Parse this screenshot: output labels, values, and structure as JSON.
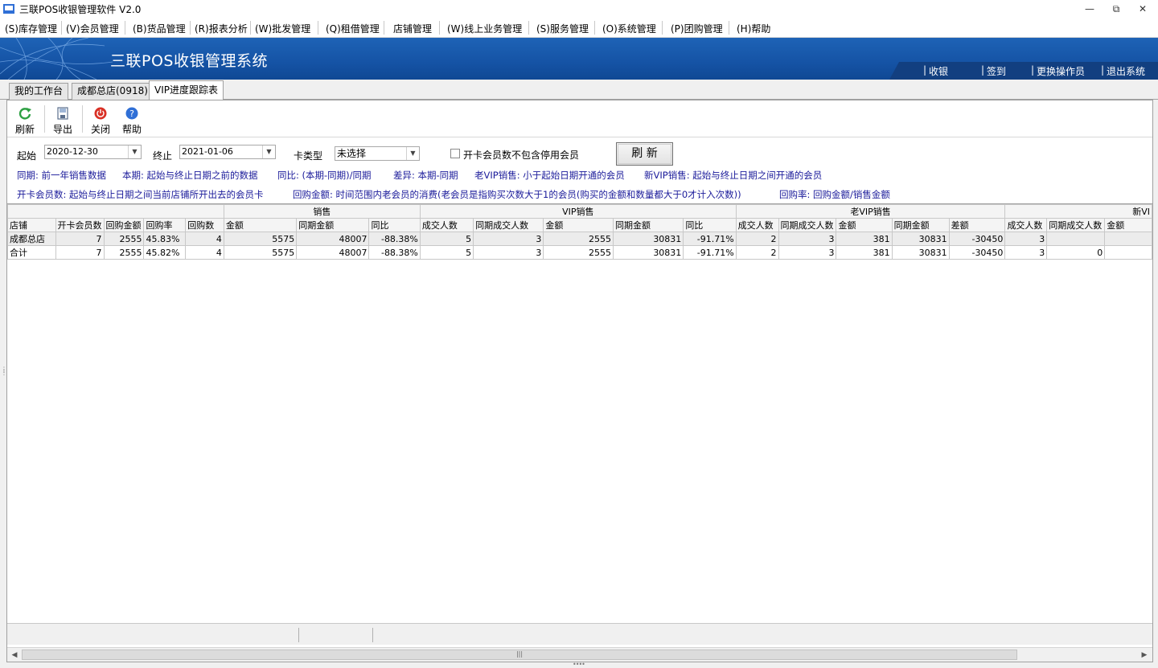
{
  "window": {
    "title": "三联POS收银管理软件 V2.0",
    "controls": {
      "minimize": "—",
      "restore": "⧉",
      "close": "✕"
    }
  },
  "menu": [
    "(S)库存管理",
    "(V)会员管理",
    "(B)货品管理",
    "(R)报表分析",
    "(W)批发管理",
    "(Q)租借管理",
    "店铺管理",
    "(W)线上业务管理",
    "(S)服务管理",
    "(O)系统管理",
    "(P)团购管理",
    "(H)帮助"
  ],
  "banner": {
    "title": "三联POS收银管理系统",
    "links": [
      "收银",
      "签到",
      "更换操作员",
      "退出系统"
    ],
    "link_prefix": "|"
  },
  "tabs": [
    "我的工作台",
    "成都总店(0918)",
    "VIP进度跟踪表"
  ],
  "active_tab": 2,
  "toolbar": {
    "refresh": "刷新",
    "export": "导出",
    "close": "关闭",
    "help": "帮助"
  },
  "filters": {
    "start_label": "起始",
    "start_value": "2020-12-30",
    "end_label": "终止",
    "end_value": "2021-01-06",
    "card_type_label": "卡类型",
    "card_type_value": "未选择",
    "exclude_label": "开卡会员数不包含停用会员",
    "refresh_button": "刷 新"
  },
  "legend": {
    "line1": [
      "同期: 前一年销售数据",
      "本期: 起始与终止日期之前的数据",
      "同比: (本期-同期)/同期",
      "差异: 本期-同期",
      "老VIP销售: 小于起始日期开通的会员",
      "新VIP销售: 起始与终止日期之间开通的会员"
    ],
    "line2": [
      "开卡会员数: 起始与终止日期之间当前店铺所开出去的会员卡",
      "回购金额: 时间范围内老会员的消费(老会员是指购买次数大于1的会员(购买的金额和数量都大于0才计入次数))",
      "回购率: 回购金额/销售金额"
    ]
  },
  "grid": {
    "groups": [
      "",
      "销售",
      "VIP销售",
      "老VIP销售",
      "新VI"
    ],
    "columns": [
      "店铺",
      "开卡会员数",
      "回购金额",
      "回购率",
      "回购数",
      "金额",
      "同期金额",
      "同比",
      "成交人数",
      "同期成交人数",
      "金额",
      "同期金额",
      "同比",
      "成交人数",
      "同期成交人数",
      "金额",
      "同期金额",
      "差额",
      "成交人数",
      "同期成交人数",
      "金额"
    ],
    "rows": [
      [
        "成都总店",
        "7",
        "2555",
        "45.83%",
        "4",
        "5575",
        "48007",
        "-88.38%",
        "5",
        "3",
        "2555",
        "30831",
        "-91.71%",
        "2",
        "3",
        "381",
        "30831",
        "-30450",
        "3",
        "",
        ""
      ],
      [
        "合计",
        "7",
        "2555",
        "45.82%",
        "4",
        "5575",
        "48007",
        "-88.38%",
        "5",
        "3",
        "2555",
        "30831",
        "-91.71%",
        "2",
        "3",
        "381",
        "30831",
        "-30450",
        "3",
        "0",
        ""
      ]
    ]
  },
  "scrollbar": {
    "thumb_grip": "|||"
  },
  "colors": {
    "banner": "#1553a5",
    "legend_text": "#1a1a9a",
    "refresh_icon": "#2ea043",
    "close_icon": "#d93025",
    "help_icon": "#2f6fd6"
  }
}
